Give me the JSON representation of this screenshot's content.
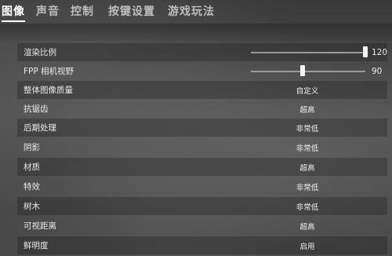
{
  "tabs": [
    {
      "label": "图像",
      "active": true
    },
    {
      "label": "声音",
      "active": false
    },
    {
      "label": "控制",
      "active": false
    },
    {
      "label": "按键设置",
      "active": false
    },
    {
      "label": "游戏玩法",
      "active": false
    }
  ],
  "settings": {
    "render_scale": {
      "label": "渲染比例",
      "value": "120",
      "level": 1.0
    },
    "fpp_fov": {
      "label": "FPP 相机视野",
      "value": "90",
      "level": 0.45
    },
    "overall_quality": {
      "label": "整体图像质量",
      "value": "自定义"
    },
    "anti_aliasing": {
      "label": "抗锯齿",
      "value": "超高"
    },
    "post_processing": {
      "label": "后期处理",
      "value": "非常低"
    },
    "shadows": {
      "label": "阴影",
      "value": "非常低"
    },
    "textures": {
      "label": "材质",
      "value": "超高"
    },
    "effects": {
      "label": "特效",
      "value": "非常低"
    },
    "foliage": {
      "label": "树木",
      "value": "非常低"
    },
    "view_distance": {
      "label": "可视距离",
      "value": "超高"
    },
    "sharpen": {
      "label": "鲜明度",
      "value": "启用"
    }
  }
}
